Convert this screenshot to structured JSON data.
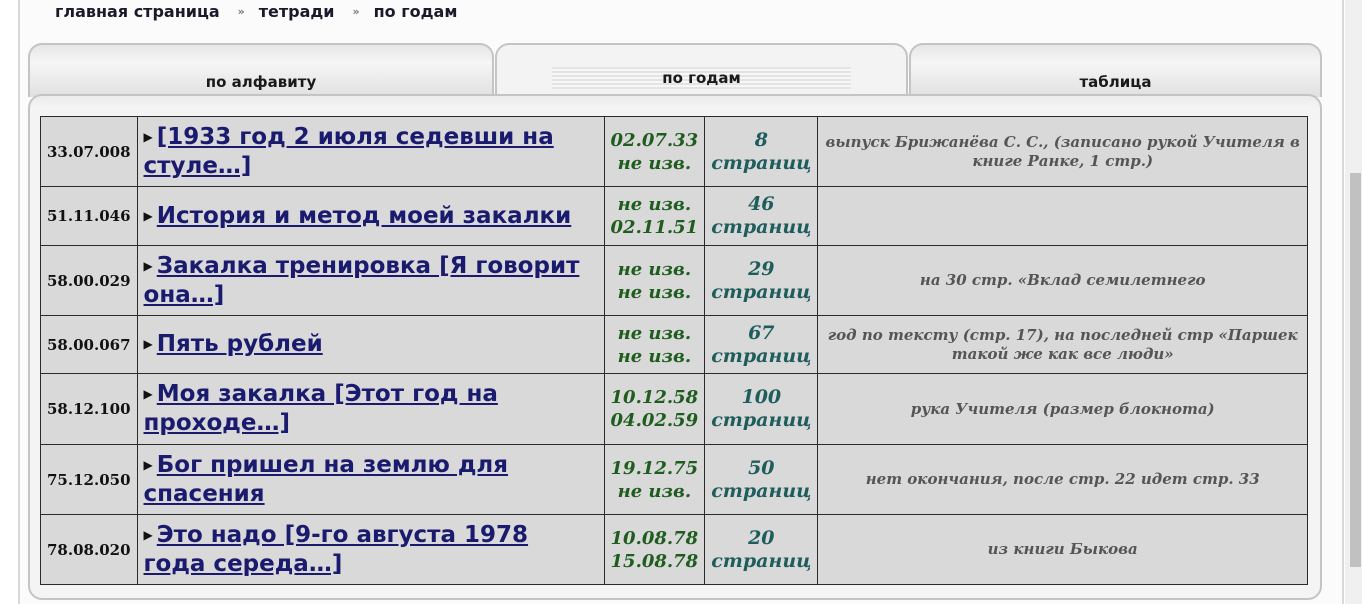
{
  "breadcrumb": {
    "home": "главная страница",
    "notebooks": "тетради",
    "current": "по годам",
    "separator": "»"
  },
  "tabs": [
    {
      "label": "по алфавиту",
      "active": false
    },
    {
      "label": "по годам",
      "active": true
    },
    {
      "label": "таблица",
      "active": false
    }
  ],
  "rows": [
    {
      "code": "33.07.008",
      "title": "[1933 год 2 июля седевши на стуле…]",
      "date1": "02.07.33",
      "date2": "не изв.",
      "pages_num": "8",
      "pages_word": "страниц",
      "note": "выпуск Брижанёва С. С., (записано рукой Учителя в книге Ранке, 1 стр.)"
    },
    {
      "code": "51.11.046",
      "title": "История и метод моей закалки",
      "date1": "не изв.",
      "date2": "02.11.51",
      "pages_num": "46",
      "pages_word": "страниц",
      "note": ""
    },
    {
      "code": "58.00.029",
      "title": "Закалка тренировка [Я говорит она…]",
      "date1": "не изв.",
      "date2": "не изв.",
      "pages_num": "29",
      "pages_word": "страниц",
      "note": "на 30 стр. «Вклад семилетнего"
    },
    {
      "code": "58.00.067",
      "title": "Пять рублей",
      "date1": "не изв.",
      "date2": "не изв.",
      "pages_num": "67",
      "pages_word": "страниц",
      "note": "год по тексту (стр. 17), на последней стр «Паршек такой же как все люди»"
    },
    {
      "code": "58.12.100",
      "title": "Моя закалка [Этот год на проходе…]",
      "date1": "10.12.58",
      "date2": "04.02.59",
      "pages_num": "100",
      "pages_word": "страниц",
      "note": "рука Учителя (размер блокнота)"
    },
    {
      "code": "75.12.050",
      "title": "Бог пришел на землю для спасения",
      "date1": "19.12.75",
      "date2": "не изв.",
      "pages_num": "50",
      "pages_word": "страниц",
      "note": "нет окончания, после стр. 22 идет стр. 33"
    },
    {
      "code": "78.08.020",
      "title": "Это надо [9-го августа 1978 года середа…]",
      "date1": "10.08.78",
      "date2": "15.08.78",
      "pages_num": "20",
      "pages_word": "страниц",
      "note": "из книги Быкова"
    }
  ]
}
